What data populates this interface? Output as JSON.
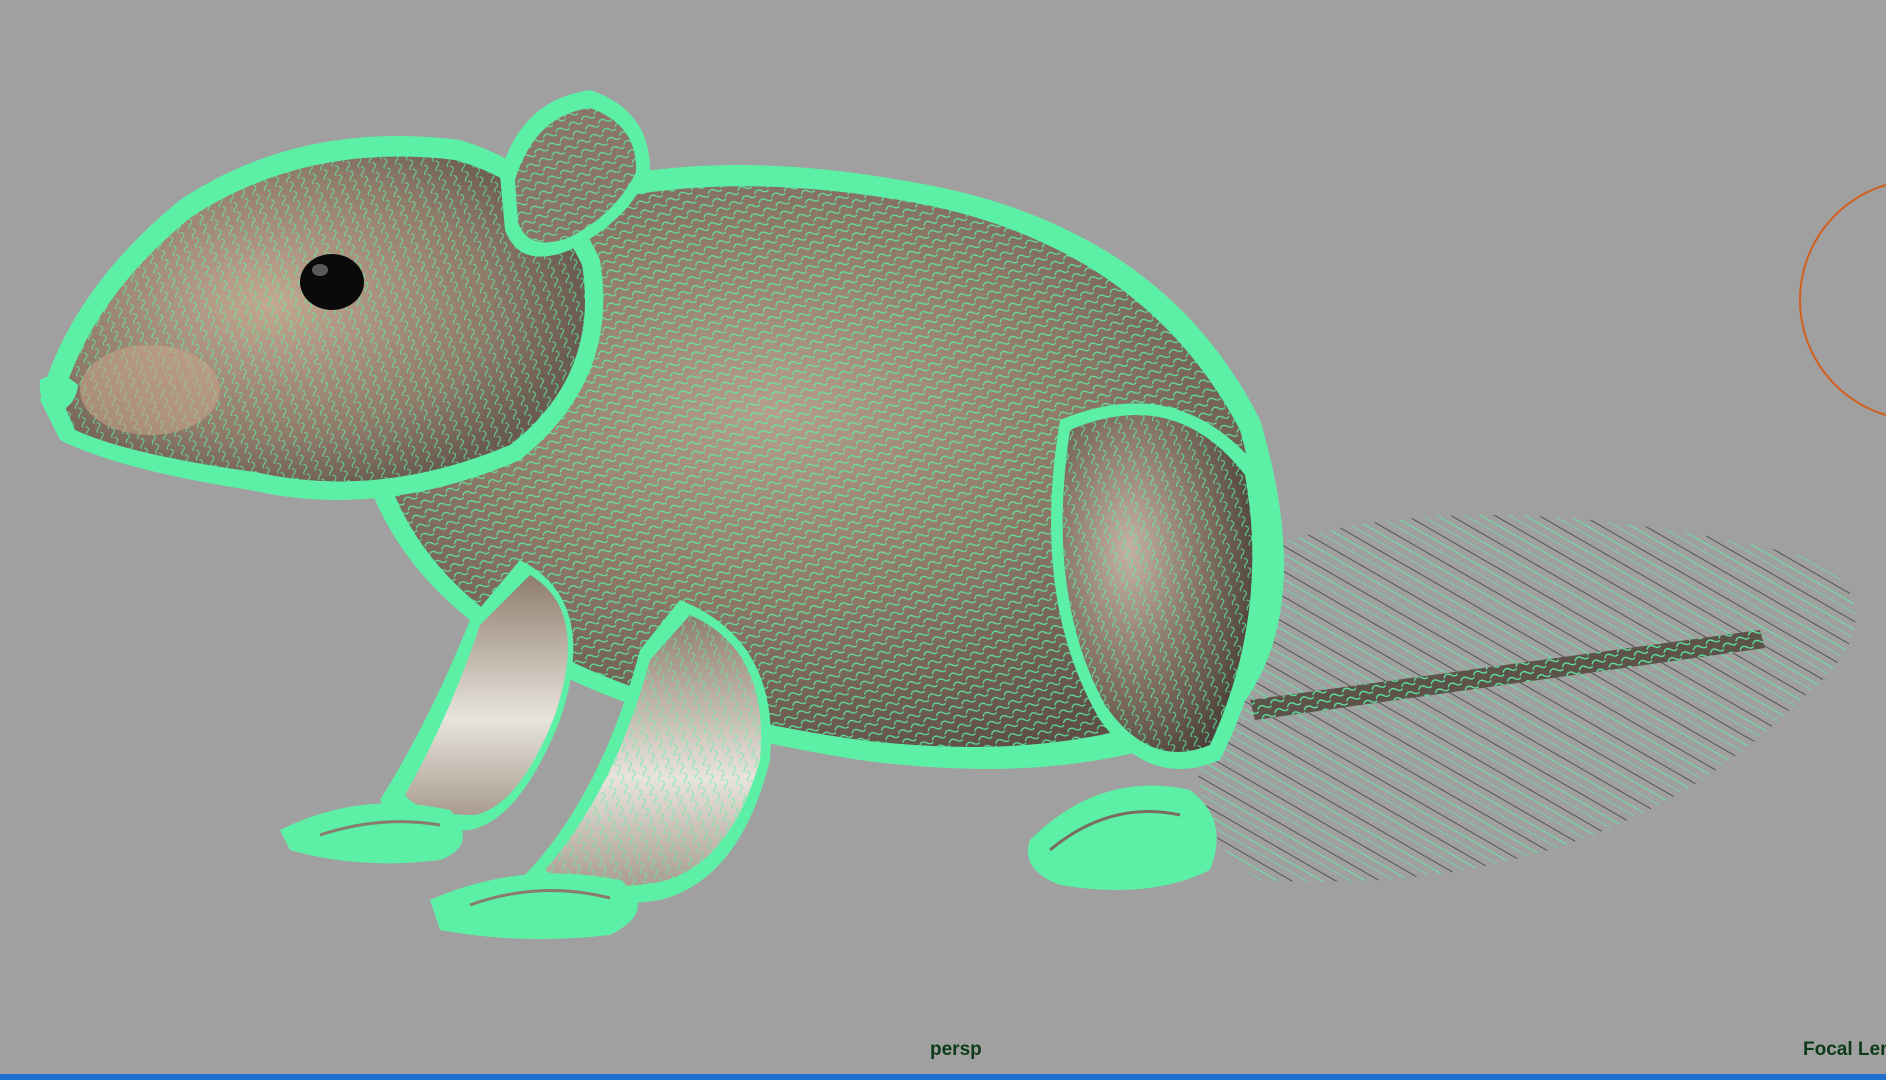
{
  "viewport": {
    "camera_name": "persp",
    "hud_focal_length_label": "Focal Len",
    "background_color": "#a0a0a0",
    "fur_color": "#5cf0a6",
    "body_color": "#8e7c6e",
    "manipulator_color": "#d2601e",
    "active_border_color": "#1f6fd1"
  },
  "scene": {
    "object": "rodent-fur-model"
  }
}
